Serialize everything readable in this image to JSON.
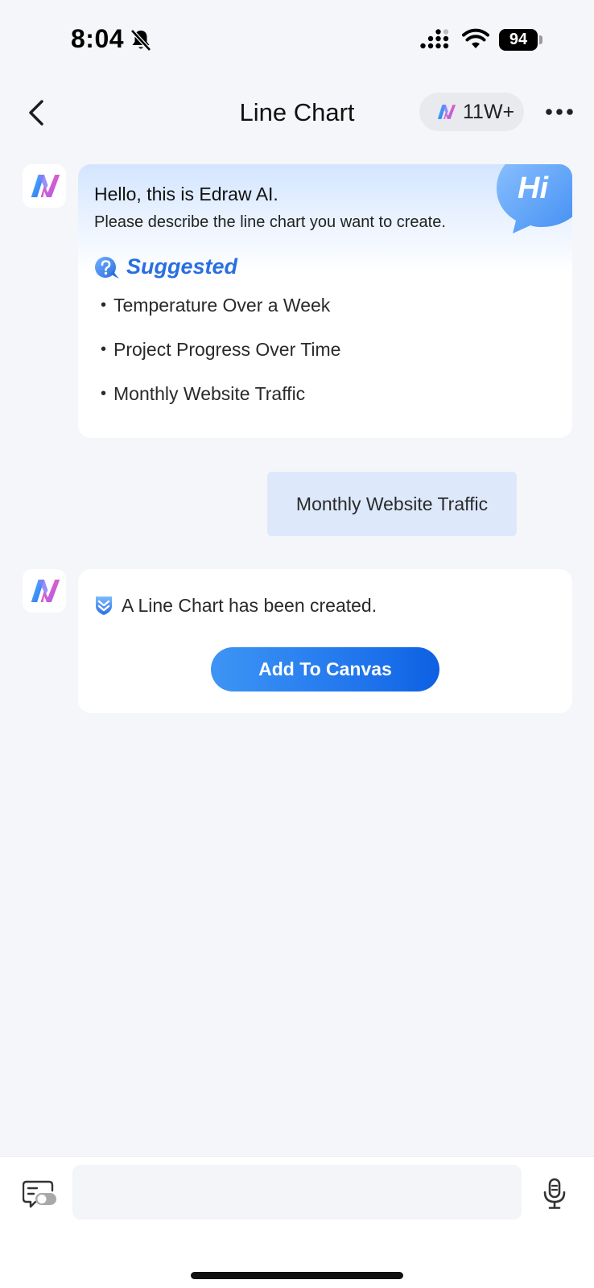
{
  "status_bar": {
    "time": "8:04",
    "battery": "94",
    "icons": [
      "bell-slash-icon",
      "signal-icon",
      "wifi-icon",
      "battery-icon"
    ]
  },
  "header": {
    "title": "Line Chart",
    "credits": "11W+",
    "back_icon": "chevron-left-icon",
    "more_icon": "more-horizontal-icon"
  },
  "greeting": {
    "title": "Hello, this is Edraw AI.",
    "subtitle": "Please describe the line chart you want to create.",
    "badge": "Hi",
    "suggested_label": "Suggested",
    "suggestions": [
      "Temperature Over a Week",
      "Project Progress Over Time",
      "Monthly Website Traffic"
    ]
  },
  "user_message": "Monthly Website Traffic",
  "result": {
    "text": "A Line Chart has been created.",
    "button_label": "Add To Canvas"
  },
  "input": {
    "placeholder": ""
  },
  "colors": {
    "accent": "#1e73ec",
    "suggested": "#2a6fe0",
    "user_bubble": "#dde9fb",
    "background": "#f5f6f9"
  }
}
